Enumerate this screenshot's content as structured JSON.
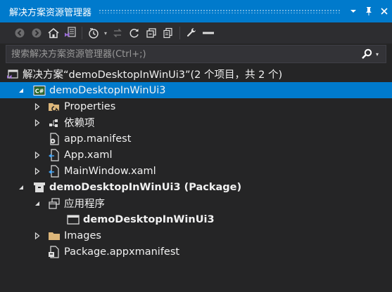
{
  "window": {
    "title": "解决方案资源管理器"
  },
  "title_buttons": {
    "dropdown_glyph": "▾",
    "close_glyph": "✕"
  },
  "search": {
    "placeholder": "搜索解决方案资源管理器(Ctrl+;)",
    "value": ""
  },
  "solution": {
    "label": "解决方案“demoDesktopInWinUi3”(2 个项目，共 2 个)"
  },
  "tree": {
    "project": {
      "label": "demoDesktopInWinUi3",
      "items": [
        {
          "label": "Properties"
        },
        {
          "label": "依赖项"
        },
        {
          "label": "app.manifest"
        },
        {
          "label": "App.xaml"
        },
        {
          "label": "MainWindow.xaml"
        }
      ]
    },
    "package": {
      "label": "demoDesktopInWinUi3 (Package)",
      "applications": {
        "label": "应用程序",
        "items": [
          {
            "label": "demoDesktopInWinUi3"
          }
        ]
      },
      "items": [
        {
          "label": "Images"
        },
        {
          "label": "Package.appxmanifest"
        }
      ]
    }
  },
  "colors": {
    "accent": "#007acc",
    "background": "#252526",
    "toolbar": "#2d2d30",
    "vs_purple": "#68217a",
    "folder": "#dcb67a"
  }
}
